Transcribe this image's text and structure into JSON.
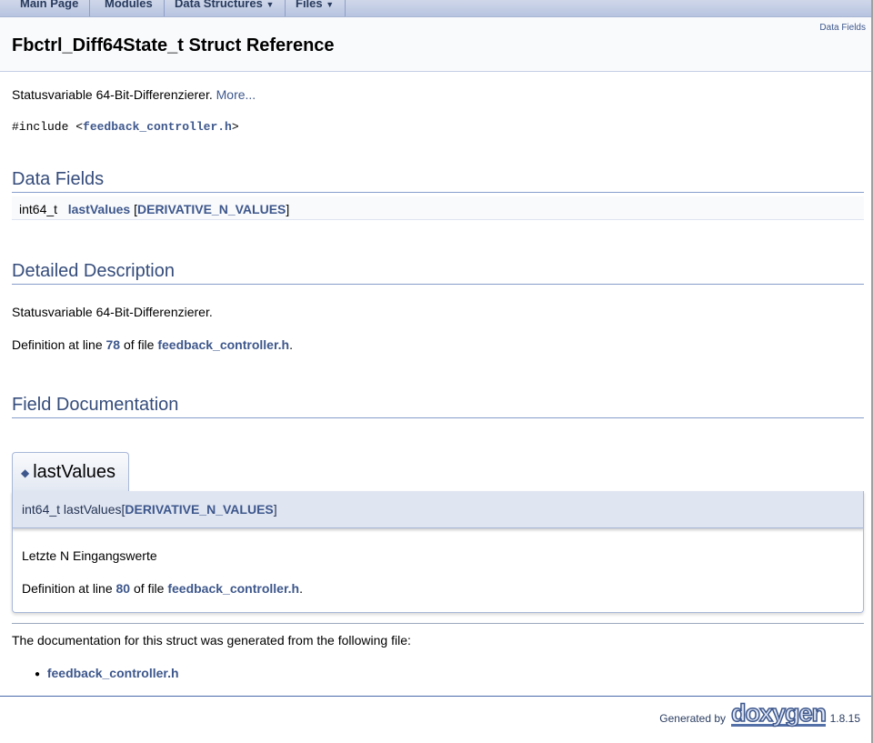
{
  "nav": {
    "items": [
      "Main Page",
      "Modules",
      "Data Structures",
      "Files"
    ]
  },
  "header": {
    "title": "Fbctrl_Diff64State_t Struct Reference",
    "summary_link": "Data Fields"
  },
  "brief": {
    "text": "Statusvariable 64-Bit-Differenzierer.",
    "more": "More..."
  },
  "include": {
    "prefix": "#include <",
    "file": "feedback_controller.h",
    "suffix": ">"
  },
  "data_fields": {
    "heading": "Data Fields",
    "type": "int64_t",
    "name": "lastValues",
    "open": "[",
    "size": "DERIVATIVE_N_VALUES",
    "close": "]"
  },
  "detailed": {
    "heading": "Detailed Description",
    "text": "Statusvariable 64-Bit-Differenzierer.",
    "def_prefix": "Definition at line ",
    "line": "78",
    "def_mid": " of file ",
    "file": "feedback_controller.h",
    "def_end": "."
  },
  "field_doc": {
    "heading": "Field Documentation",
    "tab": "lastValues",
    "proto_prefix": "int64_t lastValues[",
    "proto_size": "DERIVATIVE_N_VALUES",
    "proto_end": "]",
    "desc": "Letzte N Eingangswerte",
    "def_prefix": "Definition at line ",
    "line": "80",
    "def_mid": " of file ",
    "file": "feedback_controller.h",
    "def_end": "."
  },
  "generated": {
    "text": "The documentation for this struct was generated from the following file:",
    "file": "feedback_controller.h"
  },
  "footer": {
    "generated_by": "Generated by",
    "logo": "doxygen",
    "version": "1.8.15"
  }
}
